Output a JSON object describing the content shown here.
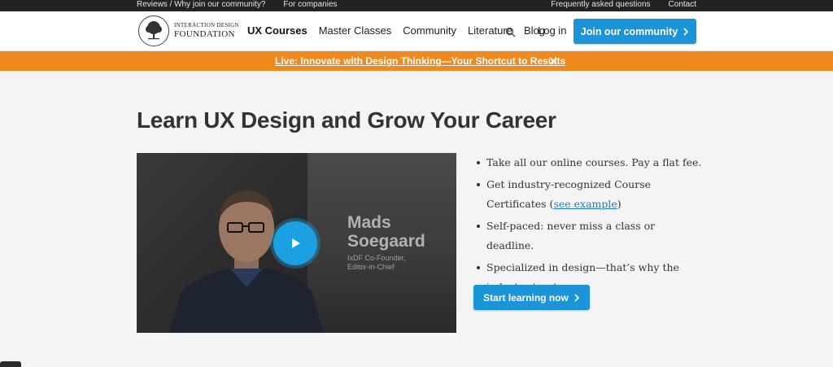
{
  "topbar": {
    "left_links": [
      "Reviews / Why join our community?",
      "For companies"
    ],
    "right_links": [
      "Frequently asked questions",
      "Contact"
    ]
  },
  "header": {
    "logo_line1": "INTERACTION DESIGN",
    "logo_line2": "FOUNDATION",
    "nav": [
      "UX Courses",
      "Master Classes",
      "Community",
      "Literature",
      "Blog"
    ],
    "login": "Log in",
    "join_button": "Join our community"
  },
  "promo": {
    "text": "Live: Innovate with Design Thinking—Your Shortcut to Results"
  },
  "hero": {
    "title": "Learn UX Design and Grow Your Career",
    "video": {
      "name_line1": "Mads",
      "name_line2": "Soegaard",
      "role_line1": "IxDF Co-Founder,",
      "role_line2": "Editor-in-Chief"
    },
    "bullets": [
      {
        "text": "Take all our online courses. Pay a flat fee."
      },
      {
        "before": "Get industry-recognized Course Certificates (",
        "link": "see example",
        "after": ")"
      },
      {
        "text": "Self-paced: never miss a class or deadline."
      },
      {
        "text": "Specialized in design—that’s why the industry trusts us."
      }
    ],
    "cta": "Start learning now"
  },
  "colors": {
    "brand_blue": "#1b94d8",
    "promo_orange": "#f08a1e",
    "topbar_dark": "#222222"
  }
}
